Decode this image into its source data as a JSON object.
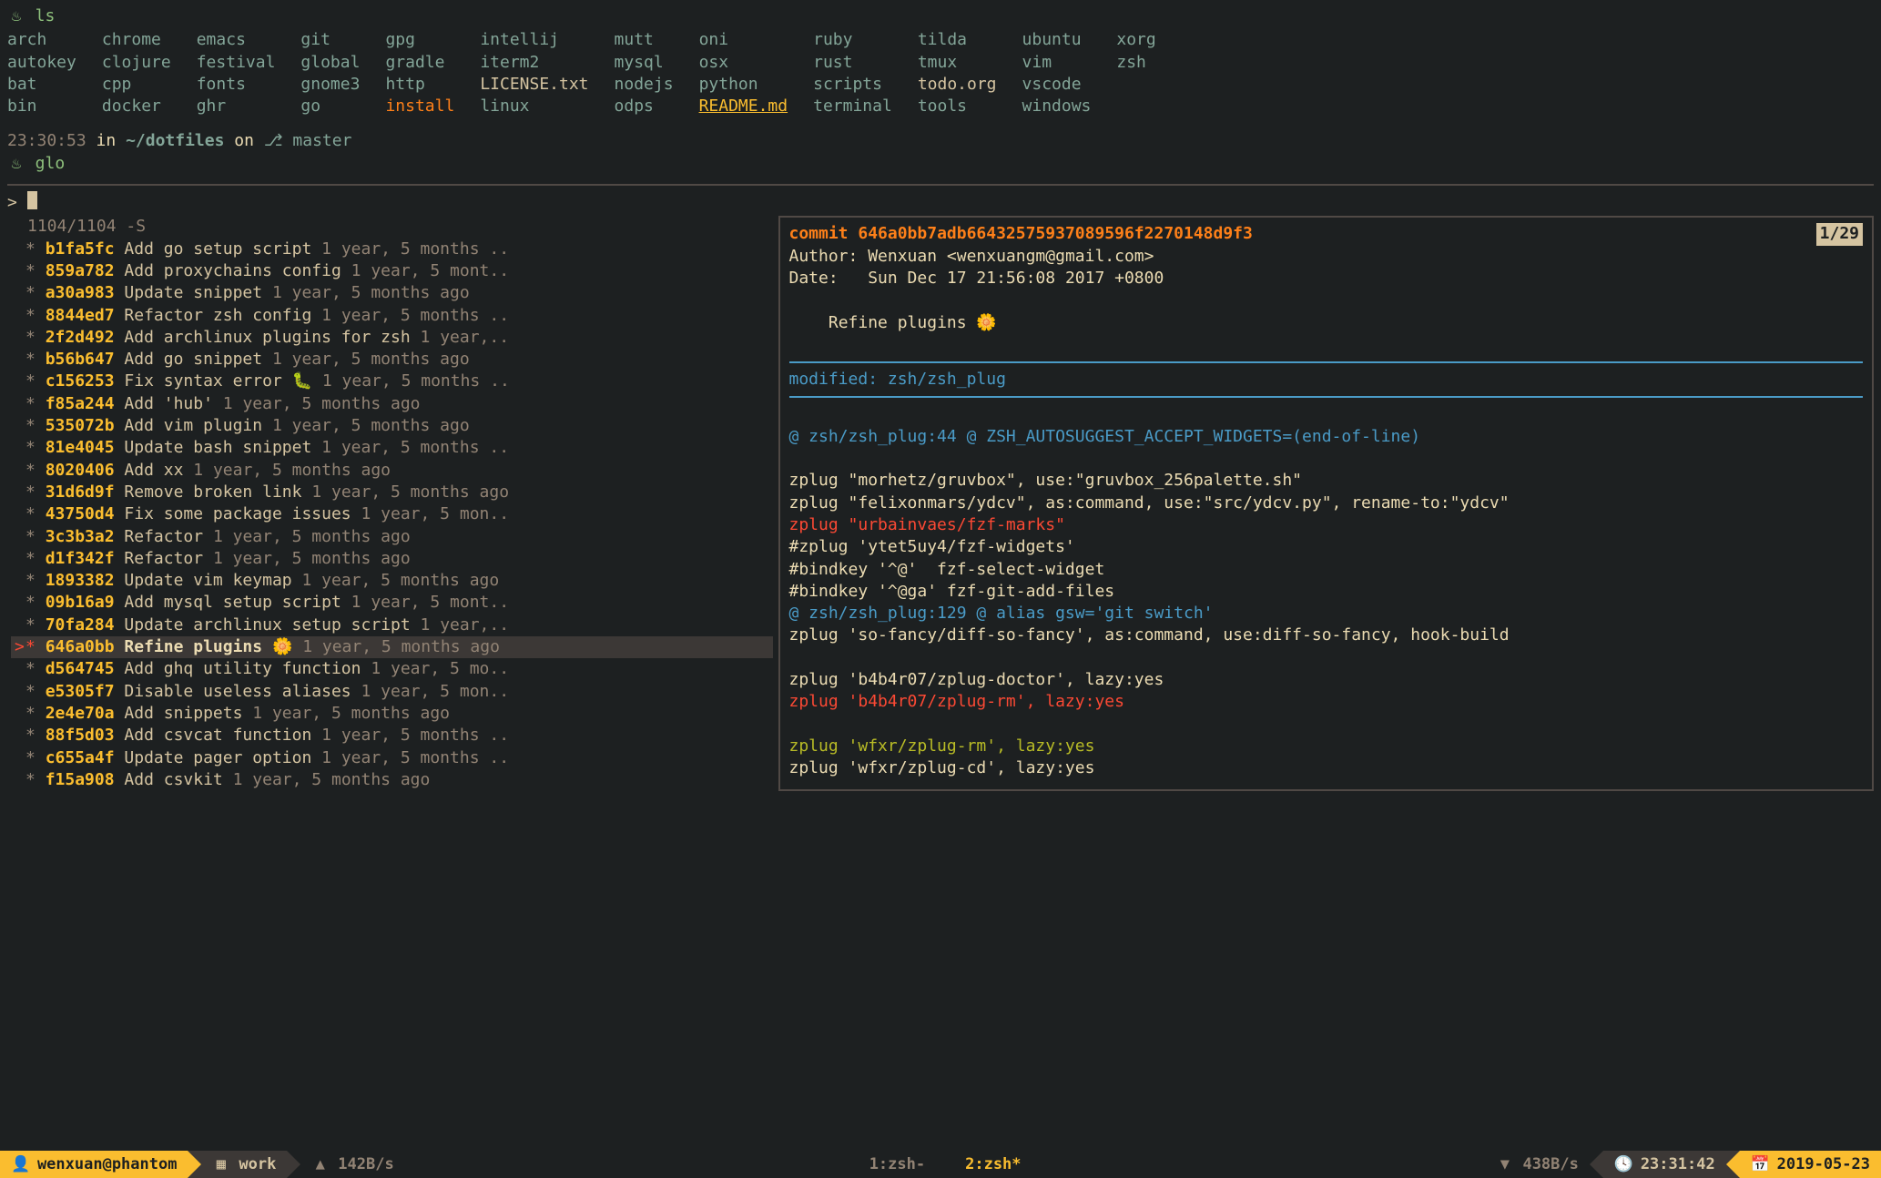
{
  "ls_cmd": "ls",
  "ls_items": [
    {
      "name": "arch",
      "type": "dir"
    },
    {
      "name": "chrome",
      "type": "dir"
    },
    {
      "name": "emacs",
      "type": "dir"
    },
    {
      "name": "git",
      "type": "dir"
    },
    {
      "name": "gpg",
      "type": "dir"
    },
    {
      "name": "intellij",
      "type": "dir"
    },
    {
      "name": "mutt",
      "type": "dir"
    },
    {
      "name": "oni",
      "type": "dir"
    },
    {
      "name": "ruby",
      "type": "dir"
    },
    {
      "name": "tilda",
      "type": "dir"
    },
    {
      "name": "ubuntu",
      "type": "dir"
    },
    {
      "name": "xorg",
      "type": "dir"
    },
    {
      "name": "autokey",
      "type": "dir"
    },
    {
      "name": "clojure",
      "type": "dir"
    },
    {
      "name": "festival",
      "type": "dir"
    },
    {
      "name": "global",
      "type": "dir"
    },
    {
      "name": "gradle",
      "type": "dir"
    },
    {
      "name": "iterm2",
      "type": "dir"
    },
    {
      "name": "mysql",
      "type": "dir"
    },
    {
      "name": "osx",
      "type": "dir"
    },
    {
      "name": "rust",
      "type": "dir"
    },
    {
      "name": "tmux",
      "type": "dir"
    },
    {
      "name": "vim",
      "type": "dir"
    },
    {
      "name": "zsh",
      "type": "dir"
    },
    {
      "name": "bat",
      "type": "dir"
    },
    {
      "name": "cpp",
      "type": "dir"
    },
    {
      "name": "fonts",
      "type": "dir"
    },
    {
      "name": "gnome3",
      "type": "dir"
    },
    {
      "name": "http",
      "type": "dir"
    },
    {
      "name": "LICENSE.txt",
      "type": "file"
    },
    {
      "name": "nodejs",
      "type": "dir"
    },
    {
      "name": "python",
      "type": "dir"
    },
    {
      "name": "scripts",
      "type": "dir"
    },
    {
      "name": "todo.org",
      "type": "file"
    },
    {
      "name": "vscode",
      "type": "dir"
    },
    {
      "name": "",
      "type": "blank"
    },
    {
      "name": "bin",
      "type": "dir"
    },
    {
      "name": "docker",
      "type": "dir"
    },
    {
      "name": "ghr",
      "type": "dir"
    },
    {
      "name": "go",
      "type": "dir"
    },
    {
      "name": "install",
      "type": "exec"
    },
    {
      "name": "linux",
      "type": "dir"
    },
    {
      "name": "odps",
      "type": "dir"
    },
    {
      "name": "README.md",
      "type": "link"
    },
    {
      "name": "terminal",
      "type": "dir"
    },
    {
      "name": "tools",
      "type": "dir"
    },
    {
      "name": "windows",
      "type": "dir"
    },
    {
      "name": "",
      "type": "blank"
    }
  ],
  "prompt": {
    "time": "23:30:53",
    "in_word": "in",
    "path": "~/dotfiles",
    "on_word": "on",
    "branch_icon": "",
    "branch": "master"
  },
  "glo_cmd": "glo",
  "fzf": {
    "query_prefix": "> ",
    "counter": "1104/1104 -S",
    "commits": [
      {
        "hash": "b1fa5fc",
        "msg": "Add go setup script",
        "time": "1 year, 5 months ..",
        "sel": false
      },
      {
        "hash": "859a782",
        "msg": "Add proxychains config",
        "time": "1 year, 5 mont..",
        "sel": false
      },
      {
        "hash": "a30a983",
        "msg": "Update snippet",
        "time": "1 year, 5 months ago",
        "sel": false
      },
      {
        "hash": "8844ed7",
        "msg": "Refactor zsh config",
        "time": "1 year, 5 months ..",
        "sel": false
      },
      {
        "hash": "2f2d492",
        "msg": "Add archlinux plugins for zsh",
        "time": "1 year,..",
        "sel": false
      },
      {
        "hash": "b56b647",
        "msg": "Add go snippet",
        "time": "1 year, 5 months ago",
        "sel": false
      },
      {
        "hash": "c156253",
        "msg": "Fix syntax error 🐛",
        "time": "1 year, 5 months ..",
        "sel": false
      },
      {
        "hash": "f85a244",
        "msg": "Add 'hub'",
        "time": "1 year, 5 months ago",
        "sel": false
      },
      {
        "hash": "535072b",
        "msg": "Add vim plugin",
        "time": "1 year, 5 months ago",
        "sel": false
      },
      {
        "hash": "81e4045",
        "msg": "Update bash snippet",
        "time": "1 year, 5 months ..",
        "sel": false
      },
      {
        "hash": "8020406",
        "msg": "Add xx",
        "time": "1 year, 5 months ago",
        "sel": false
      },
      {
        "hash": "31d6d9f",
        "msg": "Remove broken link",
        "time": "1 year, 5 months ago",
        "sel": false
      },
      {
        "hash": "43750d4",
        "msg": "Fix some package issues",
        "time": "1 year, 5 mon..",
        "sel": false
      },
      {
        "hash": "3c3b3a2",
        "msg": "Refactor",
        "time": "1 year, 5 months ago",
        "sel": false
      },
      {
        "hash": "d1f342f",
        "msg": "Refactor",
        "time": "1 year, 5 months ago",
        "sel": false
      },
      {
        "hash": "1893382",
        "msg": "Update vim keymap",
        "time": "1 year, 5 months ago",
        "sel": false
      },
      {
        "hash": "09b16a9",
        "msg": "Add mysql setup script",
        "time": "1 year, 5 mont..",
        "sel": false
      },
      {
        "hash": "70fa284",
        "msg": "Update archlinux setup script",
        "time": "1 year,..",
        "sel": false
      },
      {
        "hash": "646a0bb",
        "msg": "Refine plugins 🌼",
        "time": "1 year, 5 months ago",
        "sel": true
      },
      {
        "hash": "d564745",
        "msg": "Add ghq utility function",
        "time": "1 year, 5 mo..",
        "sel": false
      },
      {
        "hash": "e5305f7",
        "msg": "Disable useless aliases",
        "time": "1 year, 5 mon..",
        "sel": false
      },
      {
        "hash": "2e4e70a",
        "msg": "Add snippets",
        "time": "1 year, 5 months ago",
        "sel": false
      },
      {
        "hash": "88f5d03",
        "msg": "Add csvcat function",
        "time": "1 year, 5 months ..",
        "sel": false
      },
      {
        "hash": "c655a4f",
        "msg": "Update pager option",
        "time": "1 year, 5 months ..",
        "sel": false
      },
      {
        "hash": "f15a908",
        "msg": "Add csvkit",
        "time": "1 year, 5 months ago",
        "sel": false
      }
    ],
    "preview": {
      "badge": "1/29",
      "commit_label": "commit",
      "commit_hash": "646a0bb7adb66432575937089596f2270148d9f3",
      "author_label": "Author:",
      "author_value": "Wenxuan <wenxuangm@gmail.com>",
      "date_label": "Date:",
      "date_value": "Sun Dec 17 21:56:08 2017 +0800",
      "title": "Refine plugins 🌼",
      "modified": "modified: zsh/zsh_plug",
      "hunk1": "@ zsh/zsh_plug:44 @ ZSH_AUTOSUGGEST_ACCEPT_WIDGETS=(end-of-line)",
      "body": [
        {
          "t": "",
          "c": ""
        },
        {
          "t": "zplug \"morhetz/gruvbox\", use:\"gruvbox_256palette.sh\"",
          "c": "white"
        },
        {
          "t": "zplug \"felixonmars/ydcv\", as:command, use:\"src/ydcv.py\", rename-to:\"ydcv\"",
          "c": "white"
        },
        {
          "t": "zplug \"urbainvaes/fzf-marks\"",
          "c": "red"
        },
        {
          "t": "#zplug 'ytet5uy4/fzf-widgets'",
          "c": "white"
        },
        {
          "t": "#bindkey '^@'  fzf-select-widget",
          "c": "white"
        },
        {
          "t": "#bindkey '^@ga' fzf-git-add-files",
          "c": "white"
        },
        {
          "t": "@ zsh/zsh_plug:129 @ alias gsw='git switch'",
          "c": "blue"
        },
        {
          "t": "zplug 'so-fancy/diff-so-fancy', as:command, use:diff-so-fancy, hook-build",
          "c": "white"
        },
        {
          "t": "",
          "c": ""
        },
        {
          "t": "zplug 'b4b4r07/zplug-doctor', lazy:yes",
          "c": "white"
        },
        {
          "t": "zplug 'b4b4r07/zplug-rm', lazy:yes",
          "c": "red"
        },
        {
          "t": "",
          "c": ""
        },
        {
          "t": "zplug 'wfxr/zplug-rm', lazy:yes",
          "c": "green"
        },
        {
          "t": "zplug 'wfxr/zplug-cd', lazy:yes",
          "c": "white"
        }
      ]
    }
  },
  "status": {
    "user": "wenxuan@phantom",
    "session": "work",
    "up": "142B/s",
    "tabs": [
      {
        "idx": "1",
        "name": "zsh-",
        "active": false
      },
      {
        "idx": "2",
        "name": "zsh*",
        "active": true
      }
    ],
    "down": "438B/s",
    "clock": "23:31:42",
    "date": "2019-05-23"
  },
  "icons": {
    "flame": "♨",
    "branch": "⎇",
    "user": "👤",
    "grid": "▦",
    "up": "▲",
    "down": "▼",
    "clock": "🕓",
    "cal": "📅"
  }
}
